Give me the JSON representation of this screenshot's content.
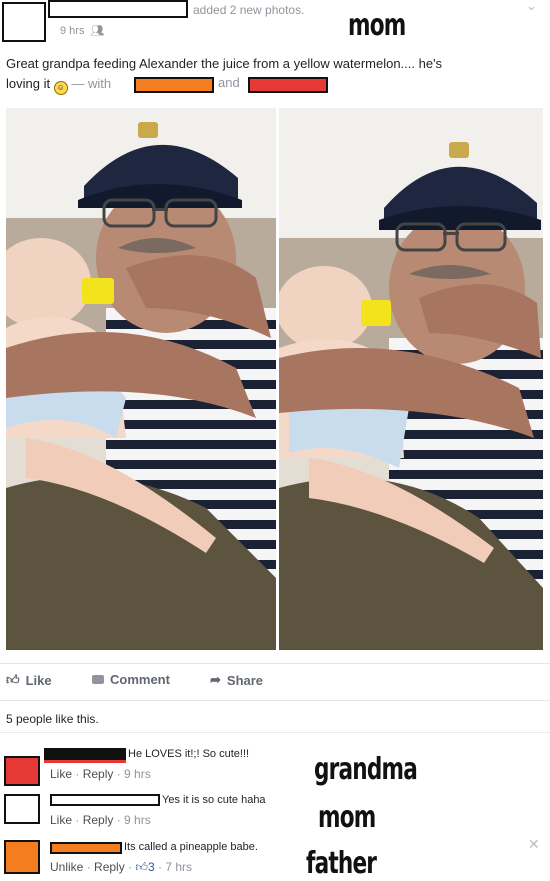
{
  "post": {
    "header_action": "added 2 new photos.",
    "timestamp": "9 hrs",
    "annotation": "mom",
    "text_main": "Great grandpa feeding Alexander the juice from a yellow watermelon.... he's",
    "text_line2_start": "loving it",
    "text_with": "— with",
    "text_and": "and"
  },
  "actions": {
    "like": "Like",
    "comment": "Comment",
    "share": "Share"
  },
  "likes_summary": "5 people like this.",
  "comments": [
    {
      "text": "He LOVES it!;! So cute!!!",
      "like_label": "Like",
      "reply_label": "Reply",
      "time": "9 hrs",
      "annotation": "grandma",
      "avatar_color": "#e53935"
    },
    {
      "text": "Yes it is so cute haha",
      "like_label": "Like",
      "reply_label": "Reply",
      "time": "9 hrs",
      "annotation": "mom",
      "avatar_color": "#ffffff"
    },
    {
      "text": "Its called a pineapple babe.",
      "like_label": "Unlike",
      "reply_label": "Reply",
      "like_count": "3",
      "time": "7 hrs",
      "annotation": "father",
      "avatar_color": "#f47d20"
    }
  ],
  "colors": {
    "redact_orange": "#f47d20",
    "redact_red": "#e53935",
    "link_blue": "#365899"
  }
}
